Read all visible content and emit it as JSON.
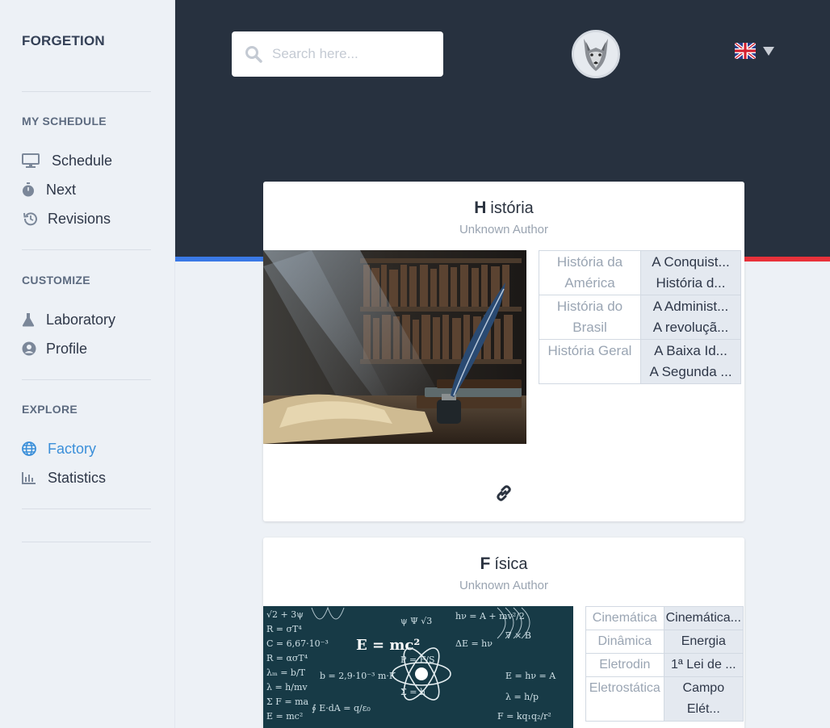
{
  "sidebar": {
    "brand": "FORGETION",
    "sections": [
      {
        "title": "MY SCHEDULE",
        "items": [
          {
            "label": "Schedule",
            "icon": "monitor-icon"
          },
          {
            "label": "Next",
            "icon": "stopwatch-icon"
          },
          {
            "label": "Revisions",
            "icon": "history-icon"
          }
        ]
      },
      {
        "title": "CUSTOMIZE",
        "items": [
          {
            "label": "Laboratory",
            "icon": "flask-icon"
          },
          {
            "label": "Profile",
            "icon": "user-circle-icon"
          }
        ]
      },
      {
        "title": "EXPLORE",
        "items": [
          {
            "label": "Factory",
            "icon": "globe-icon",
            "active": true
          },
          {
            "label": "Statistics",
            "icon": "bar-chart-icon"
          }
        ]
      }
    ]
  },
  "header": {
    "search_placeholder": "Search here...",
    "language": "English (UK)"
  },
  "colors": {
    "header_bg": "#27313f",
    "active_link": "#3b8fd9",
    "accent_blue": "#3a79e6",
    "accent_red": "#e8313a"
  },
  "cards": [
    {
      "initial": "H",
      "title_rest": "istória",
      "author": "Unknown Author",
      "rows": [
        {
          "subject": "História da América",
          "items": [
            "A Conquist...",
            "História d..."
          ]
        },
        {
          "subject": "História do Brasil",
          "items": [
            "A Administ...",
            "A revoluçã..."
          ]
        },
        {
          "subject": "História Geral",
          "items": [
            "A Baixa Id...",
            "A Segunda ..."
          ]
        }
      ]
    },
    {
      "initial": "F",
      "title_rest": "ísica",
      "author": "Unknown Author",
      "rows": [
        {
          "subject": "Cinemática",
          "items": [
            "Cinemática..."
          ]
        },
        {
          "subject": "Dinâmica",
          "items": [
            "Energia"
          ]
        },
        {
          "subject": "Eletrodin",
          "items": [
            "1ª Lei de ..."
          ]
        },
        {
          "subject": "Eletrostática",
          "items": [
            "Campo",
            "Elét..."
          ]
        }
      ]
    }
  ]
}
